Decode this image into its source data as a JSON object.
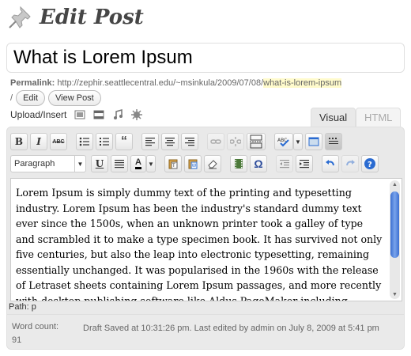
{
  "header": {
    "title": "Edit Post",
    "icon": "pushpin-icon"
  },
  "post": {
    "title": "What is Lorem Ipsum"
  },
  "permalink": {
    "label": "Permalink:",
    "base": "http://zephir.seattlecentral.edu/~msinkula/2009/07/08/",
    "slug": "what-is-lorem-ipsum",
    "trail": "/",
    "edit_label": "Edit",
    "view_label": "View Post"
  },
  "media": {
    "upload_label": "Upload/Insert",
    "icons": [
      "add-image-icon",
      "add-video-icon",
      "add-audio-icon",
      "add-media-icon"
    ]
  },
  "tabs": {
    "visual": "Visual",
    "html": "HTML",
    "active": "Visual"
  },
  "toolbar": {
    "row1": [
      "bold",
      "italic",
      "strikethrough",
      "unordered-list",
      "ordered-list",
      "blockquote",
      "align-left",
      "align-center",
      "align-right",
      "insert-link",
      "unlink",
      "insert-more",
      "spellcheck",
      "fullscreen",
      "kitchen-sink"
    ],
    "format_select": "Paragraph",
    "row2": [
      "underline",
      "justify",
      "text-color",
      "paste-text",
      "paste-word",
      "remove-format",
      "insert-media",
      "custom-character",
      "outdent",
      "indent",
      "undo",
      "redo",
      "help"
    ],
    "bold_label": "B",
    "italic_label": "I",
    "strike_label": "ABC",
    "underline_label": "U",
    "textcolor_label": "A",
    "omega_label": "Ω"
  },
  "content": {
    "text": "Lorem Ipsum is simply dummy text of the printing and typesetting industry. Lorem Ipsum has been the industry's standard dummy text ever since the 1500s, when an unknown printer took a galley of type and scrambled it to make a type specimen book. It has survived not only five centuries, but also the leap into electronic typesetting, remaining essentially unchanged. It was popularised in the 1960s with the release of Letraset sheets containing Lorem Ipsum passages, and more recently with desktop publishing software like Aldus PageMaker including versions of Lorem Ipsum."
  },
  "status": {
    "path_label": "Path: p",
    "word_count_label": "Word count:",
    "word_count": "91",
    "draft_text": "Draft Saved at 10:31:26 pm. Last edited by admin on July 8, 2009 at 5:41 pm"
  },
  "colors": {
    "editor_bg": "#e9e9e9",
    "slug_highlight": "#fffbcc",
    "scrollbar": "#5a8ae0"
  }
}
